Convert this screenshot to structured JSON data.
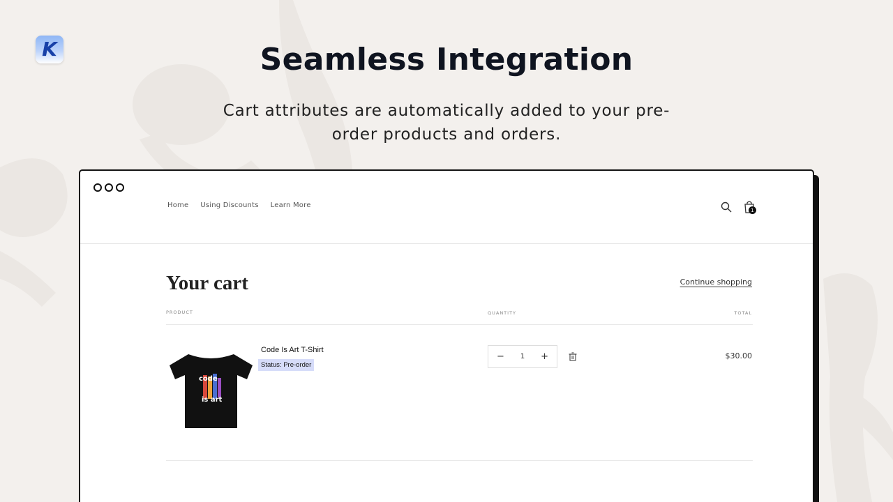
{
  "brand": {
    "logo_letter": "K"
  },
  "hero": {
    "title": "Seamless Integration",
    "subtitle": "Cart attributes are automatically added to your pre-order products and orders."
  },
  "store": {
    "nav": [
      "Home",
      "Using Discounts",
      "Learn More"
    ],
    "cart_count": "1",
    "cart_title": "Your cart",
    "continue_label": "Continue shopping",
    "columns": {
      "product": "PRODUCT",
      "quantity": "QUANTITY",
      "total": "TOTAL"
    },
    "item": {
      "name": "Code Is Art T-Shirt",
      "status": "Status: Pre-order",
      "quantity": "1",
      "price": "$30.00",
      "shirt_text_top": "code",
      "shirt_text_bottom": "is art"
    }
  },
  "colors": {
    "background": "#f3f0ed",
    "status_badge": "#d6dcf9",
    "logo_blue": "#1740a8"
  }
}
